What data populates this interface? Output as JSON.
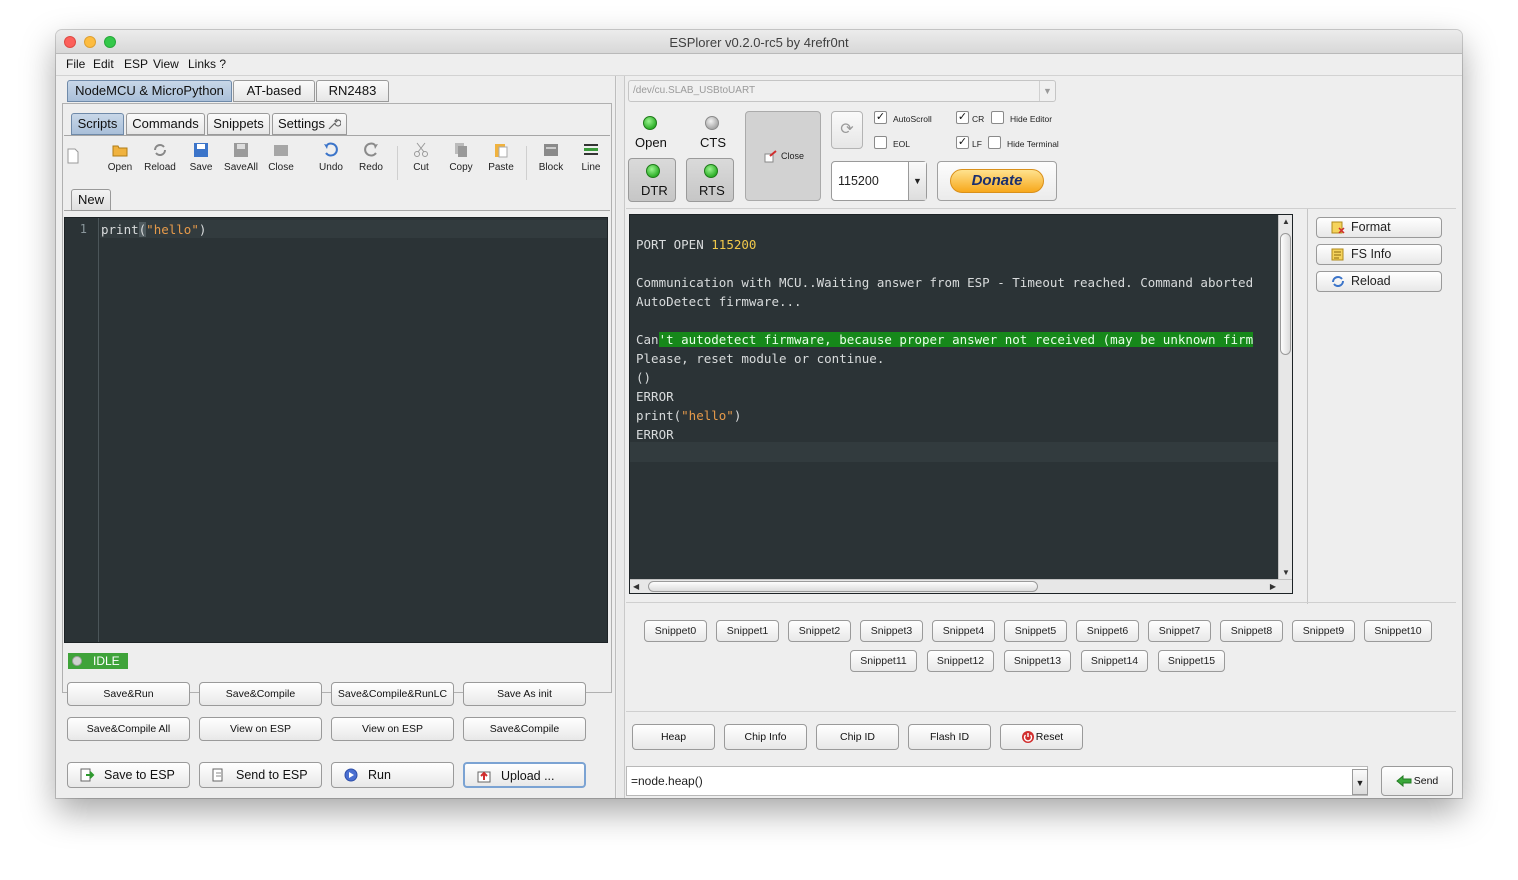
{
  "window": {
    "title": "ESPlorer v0.2.0-rc5 by 4refr0nt"
  },
  "menu": [
    "File",
    "Edit",
    "ESP",
    "View",
    "Links ?"
  ],
  "left": {
    "top_tabs": [
      "NodeMCU & MicroPython",
      "AT-based",
      "RN2483"
    ],
    "sub_tabs": [
      "Scripts",
      "Commands",
      "Snippets",
      "Settings"
    ],
    "toolbar": [
      "Open",
      "Reload",
      "Save",
      "SaveAll",
      "Close",
      "Undo",
      "Redo",
      "Cut",
      "Copy",
      "Paste",
      "Block",
      "Line"
    ],
    "file_tab": "New",
    "editor": {
      "line_number": "1",
      "code_prefix": "print",
      "code_paren_open": "(",
      "code_string": "\"hello\"",
      "code_paren_close": ")"
    },
    "status": "IDLE",
    "buttons_row1": [
      "Save&Run",
      "Save&Compile",
      "Save&Compile&RunLC",
      "Save As init"
    ],
    "buttons_row2": [
      "Save&Compile All",
      "View on ESP",
      "View on ESP",
      "Save&Compile"
    ],
    "buttons_row3": [
      "Save to ESP",
      "Send to ESP",
      "Run",
      "Upload ..."
    ]
  },
  "right": {
    "port": "/dev/cu.SLAB_USBtoUART",
    "signals": {
      "open": "Open",
      "cts": "CTS",
      "dtr": "DTR",
      "rts": "RTS"
    },
    "close_label": "Close",
    "checkboxes": {
      "autoscroll": {
        "label": "AutoScroll",
        "checked": true
      },
      "eol": {
        "label": "EOL",
        "checked": false
      },
      "cr": {
        "label": "CR",
        "checked": true
      },
      "lf": {
        "label": "LF",
        "checked": true
      },
      "hide_editor": {
        "label": "Hide Editor",
        "checked": false
      },
      "hide_terminal": {
        "label": "Hide Terminal",
        "checked": false
      }
    },
    "baud": "115200",
    "donate": "Donate",
    "terminal": {
      "port_open_prefix": "PORT OPEN ",
      "port_open_baud": "115200",
      "line_comm": "Communication with MCU..Waiting answer from ESP - Timeout reached. Command aborted",
      "line_autodetect": "AutoDetect firmware...",
      "line_cant_a": "Can",
      "line_cant_b": "'t autodetect firmware, because proper answer not received (may be unknown firm",
      "line_reset": "Please, reset module or continue.",
      "line_parens": "()",
      "line_error1": "ERROR",
      "line_print_prefix": "print(",
      "line_print_string": "\"hello\"",
      "line_print_suffix": ")",
      "line_error2": "ERROR"
    },
    "side_buttons": [
      "Format",
      "FS Info",
      "Reload"
    ],
    "snippets_row1": [
      "Snippet0",
      "Snippet1",
      "Snippet2",
      "Snippet3",
      "Snippet4",
      "Snippet5",
      "Snippet6",
      "Snippet7",
      "Snippet8",
      "Snippet9",
      "Snippet10"
    ],
    "snippets_row2": [
      "Snippet11",
      "Snippet12",
      "Snippet13",
      "Snippet14",
      "Snippet15"
    ],
    "actions": [
      "Heap",
      "Chip Info",
      "Chip ID",
      "Flash ID",
      "Reset"
    ],
    "command": "=node.heap()",
    "send": "Send"
  }
}
